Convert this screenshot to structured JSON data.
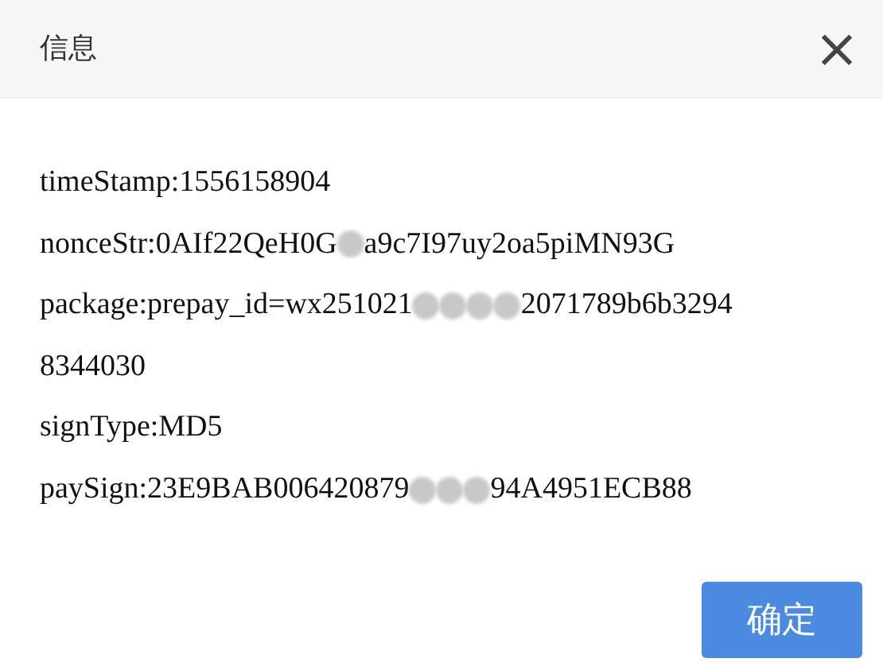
{
  "dialog": {
    "title": "信息",
    "close_icon": "×",
    "lines": [
      {
        "segments": [
          {
            "kind": "text",
            "text": "timeStamp:1556158904"
          }
        ]
      },
      {
        "segments": [
          {
            "kind": "text",
            "text": "nonceStr:0AIf22QeH0G"
          },
          {
            "kind": "redaction"
          },
          {
            "kind": "text",
            "text": "a9c7I97uy2oa5piMN93G"
          }
        ]
      },
      {
        "segments": [
          {
            "kind": "text",
            "text": "package:prepay_id=wx251021"
          },
          {
            "kind": "redaction"
          },
          {
            "kind": "redaction"
          },
          {
            "kind": "redaction"
          },
          {
            "kind": "redaction"
          },
          {
            "kind": "text",
            "text": "2071789b6b3294"
          }
        ]
      },
      {
        "segments": [
          {
            "kind": "text",
            "text": "8344030"
          }
        ]
      },
      {
        "segments": [
          {
            "kind": "text",
            "text": "signType:MD5"
          }
        ]
      },
      {
        "segments": [
          {
            "kind": "text",
            "text": "paySign:23E9BAB006420879"
          },
          {
            "kind": "redaction"
          },
          {
            "kind": "redaction"
          },
          {
            "kind": "redaction"
          },
          {
            "kind": "text",
            "text": "94A4951ECB88"
          }
        ]
      }
    ],
    "buttons": [
      "确定"
    ]
  }
}
